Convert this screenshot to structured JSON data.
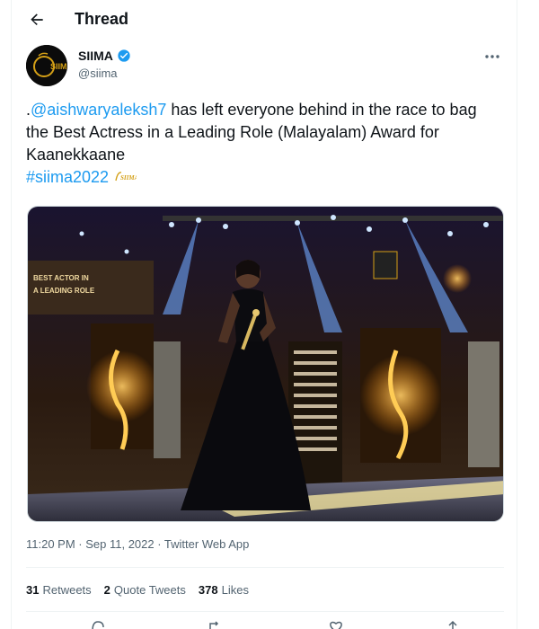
{
  "header": {
    "title": "Thread",
    "back_icon": "arrow-left-icon"
  },
  "author": {
    "name": "SIIMA",
    "handle": "@siima",
    "verified_icon": "verified-badge-icon",
    "avatar_text": "SIIMA"
  },
  "tweet": {
    "prefix": ".",
    "mention": "@aishwaryaleksh7",
    "body": " has left everyone behind in the race to bag the Best Actress in a Leading Role (Malayalam) Award for Kaanekkaane",
    "hashtag": "#siima2022",
    "emoji_text": "SIIMA"
  },
  "meta": {
    "timestamp": "11:20 PM · Sep 11, 2022 · Twitter Web App"
  },
  "stats": [
    {
      "count": "31",
      "label": "Retweets"
    },
    {
      "count": "2",
      "label": "Quote Tweets"
    },
    {
      "count": "378",
      "label": "Likes"
    }
  ],
  "colors": {
    "link": "#1d9bf0",
    "text": "#0f1419",
    "muted": "#536471",
    "gold": "#d4a017"
  }
}
